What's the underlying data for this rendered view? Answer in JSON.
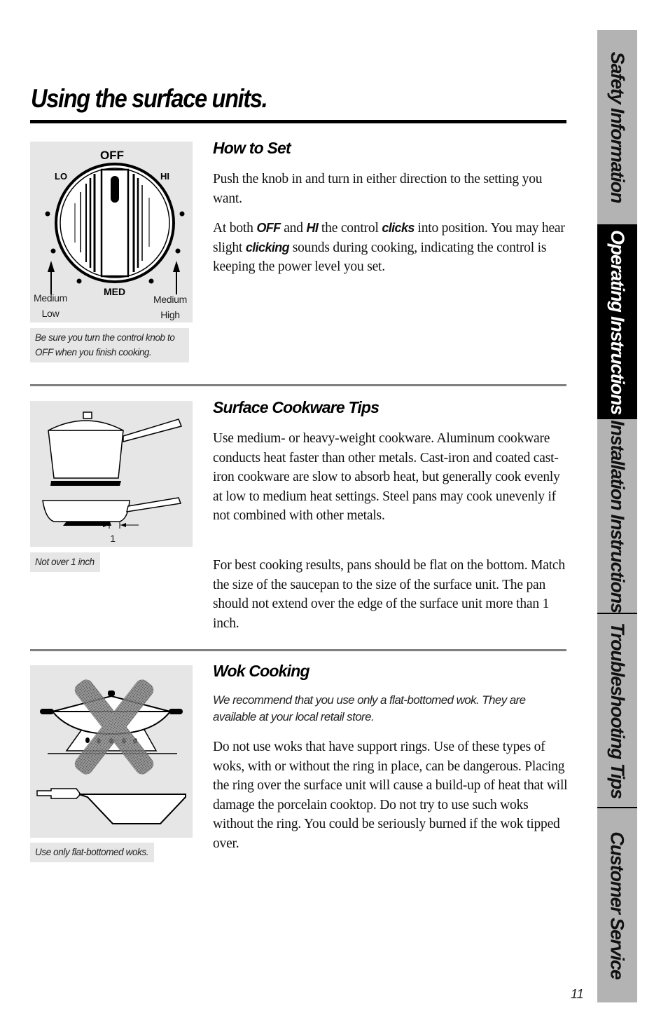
{
  "page": {
    "title": "Using the surface units.",
    "page_number": "11"
  },
  "sidebar": {
    "tabs": [
      {
        "label": "Safety Information",
        "active": false
      },
      {
        "label": "Operating Instructions",
        "active": true
      },
      {
        "label": "Installation Instructions",
        "active": false
      },
      {
        "label": "Troubleshooting Tips",
        "active": false
      },
      {
        "label": "Customer Service",
        "active": false
      }
    ]
  },
  "sections": {
    "how_to_set": {
      "heading": "How to Set",
      "paragraph1": "Push the knob in and turn in either direction to the setting you want.",
      "paragraph2": {
        "t1": "At both ",
        "em1": "OFF",
        "t2": " and ",
        "em2": "HI",
        "t3": "  the control ",
        "em3": "clicks",
        "t4": " into position. You may hear slight ",
        "em4": "clicking",
        "t5": " sounds during cooking, indicating the control is keeping the power level you set."
      },
      "figure": {
        "labels": {
          "off": "OFF",
          "lo": "LO",
          "hi": "HI",
          "med": "MED",
          "medium_low_line1": "Medium",
          "medium_low_line2": "Low",
          "medium_high_line1": "Medium",
          "medium_high_line2": "High"
        },
        "caption": "Be sure you turn the control knob to OFF when you finish cooking."
      }
    },
    "cookware_tips": {
      "heading": "Surface Cookware Tips",
      "paragraph1": "Use medium- or heavy-weight cookware. Aluminum cookware conducts heat faster than other metals. Cast-iron and coated cast-iron cookware are slow to absorb heat, but generally cook evenly at low to medium heat settings. Steel pans may cook unevenly if not combined with other metals.",
      "paragraph2": "For best cooking results, pans should be flat on the bottom. Match the size of the saucepan to the size of the surface unit. The pan should not extend over the edge of the surface unit more than 1 inch.",
      "figure": {
        "dimension_label": "1",
        "caption": "Not over 1 inch"
      }
    },
    "wok_cooking": {
      "heading": "Wok Cooking",
      "intro": "We recommend that you use only a flat-bottomed wok. They are available at your local retail store.",
      "paragraph1": "Do not use woks that have support rings. Use of these types of woks, with or without the ring in place, can be dangerous. Placing the ring over the surface unit will cause a build-up of heat that will damage the porcelain cooktop. Do not try to use such woks without the ring. You could be seriously burned if the wok tipped over.",
      "figure": {
        "caption": "Use only flat-bottomed woks."
      }
    }
  },
  "colors": {
    "sidebar_bg": "#b3b3b3",
    "sidebar_active_bg": "#000000",
    "figure_bg": "#e6e6e6",
    "divider": "#808080"
  }
}
